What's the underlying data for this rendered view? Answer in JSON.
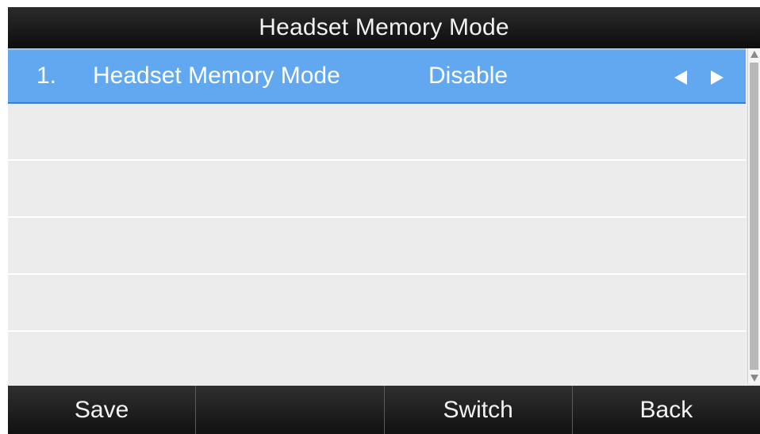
{
  "title": "Headset Memory Mode",
  "list": {
    "items": [
      {
        "index": "1.",
        "label": "Headset Memory Mode",
        "value": "Disable",
        "selected": true
      }
    ]
  },
  "softkeys": [
    "Save",
    "",
    "Switch",
    "Back"
  ],
  "colors": {
    "selection": "#62a8f0",
    "title_bar": "#1a1a1a",
    "list_background": "#ececec"
  },
  "icons": {
    "prev": "left-arrow-icon",
    "next": "right-arrow-icon",
    "scroll_up": "scroll-up-icon",
    "scroll_down": "scroll-down-icon"
  }
}
